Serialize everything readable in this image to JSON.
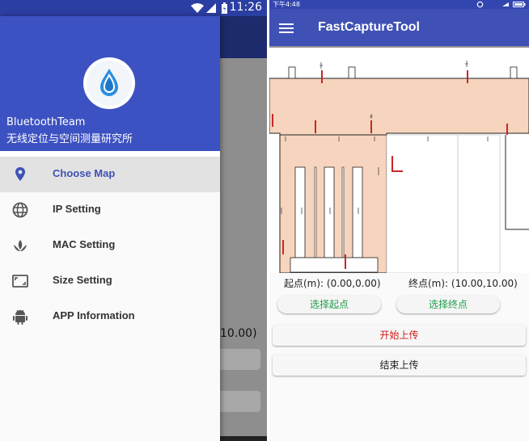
{
  "left_screen": {
    "status_time": "11:26",
    "background_partial_text": "10.00)",
    "drawer": {
      "team_name": "BluetoothTeam",
      "team_description": "无线定位与空间测量研究所",
      "items": [
        {
          "label": "Choose Map",
          "icon": "location-pin-icon",
          "active": true
        },
        {
          "label": "IP Setting",
          "icon": "globe-icon",
          "active": false
        },
        {
          "label": "MAC Setting",
          "icon": "spa-icon",
          "active": false
        },
        {
          "label": "Size Setting",
          "icon": "aspect-ratio-icon",
          "active": false
        },
        {
          "label": "APP Information",
          "icon": "android-icon",
          "active": false
        }
      ]
    }
  },
  "right_screen": {
    "status_time": "下午4:48",
    "app_title": "FastCaptureTool",
    "start_point": "起点(m): (0.00,0.00)",
    "end_point": "终点(m): (10.00,10.00)",
    "buttons": {
      "select_start": "选择起点",
      "select_end": "选择终点",
      "start_upload": "开始上传",
      "end_upload": "结束上传"
    }
  },
  "colors": {
    "primary": "#3f51b5",
    "drawer_header": "#3d52c2",
    "active_item": "#3f51b5",
    "map_fill": "#f7d4bd",
    "green_text": "#1f9d4a",
    "red_text": "#d11b1b"
  }
}
